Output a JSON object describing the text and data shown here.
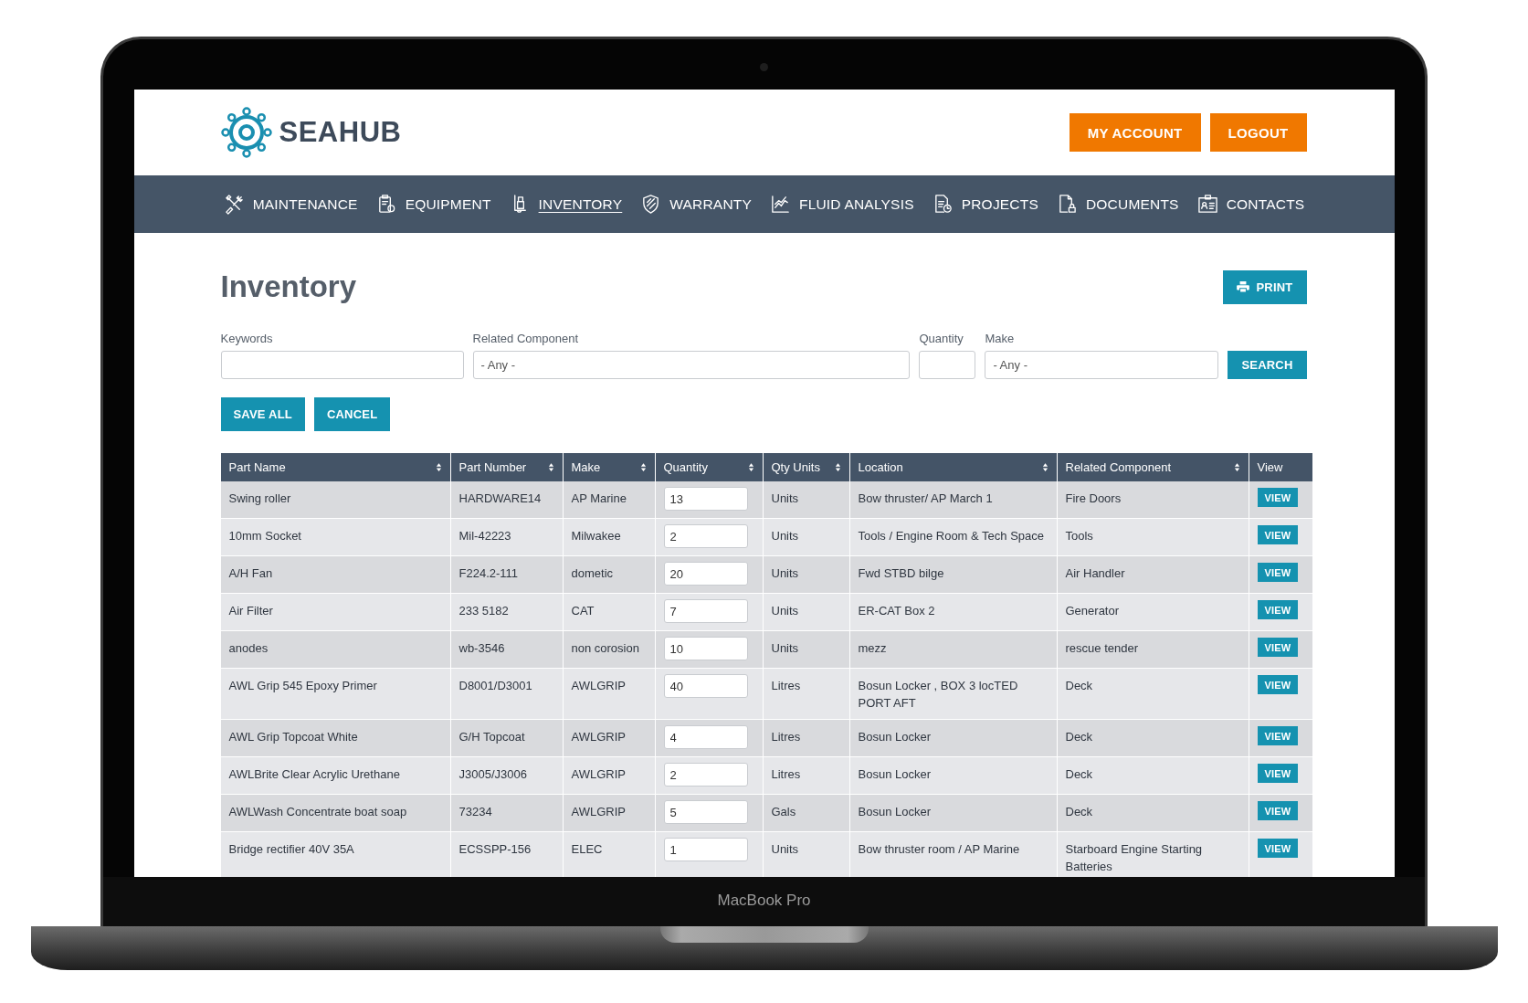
{
  "device": {
    "label": "MacBook Pro"
  },
  "header": {
    "brand": "SEAHUB",
    "buttons": [
      "MY ACCOUNT",
      "LOGOUT"
    ]
  },
  "nav": [
    {
      "label": "MAINTENANCE",
      "selected": false
    },
    {
      "label": "EQUIPMENT",
      "selected": false
    },
    {
      "label": "INVENTORY",
      "selected": true
    },
    {
      "label": "WARRANTY",
      "selected": false
    },
    {
      "label": "FLUID ANALYSIS",
      "selected": false
    },
    {
      "label": "PROJECTS",
      "selected": false
    },
    {
      "label": "DOCUMENTS",
      "selected": false
    },
    {
      "label": "CONTACTS",
      "selected": false
    }
  ],
  "page": {
    "title": "Inventory",
    "print_button": "PRINT"
  },
  "filters": [
    {
      "label": "Keywords",
      "kind": "text"
    },
    {
      "label": "Related Component",
      "kind": "select",
      "value": "- Any -"
    },
    {
      "label": "Quantity",
      "kind": "text"
    },
    {
      "label": "Make",
      "kind": "select",
      "value": "- Any -"
    }
  ],
  "search_button": "SEARCH",
  "actions": [
    "SAVE ALL",
    "CANCEL"
  ],
  "table": {
    "columns": [
      {
        "label": "Part Name",
        "sortable": true,
        "kind": "text"
      },
      {
        "label": "Part Number",
        "sortable": true,
        "kind": "text"
      },
      {
        "label": "Make",
        "sortable": true,
        "kind": "text"
      },
      {
        "label": "Quantity",
        "sortable": true,
        "kind": "input"
      },
      {
        "label": "Qty Units",
        "sortable": true,
        "kind": "text"
      },
      {
        "label": "Location",
        "sortable": true,
        "kind": "text"
      },
      {
        "label": "Related Component",
        "sortable": true,
        "kind": "text"
      },
      {
        "label": "View",
        "sortable": false,
        "kind": "button"
      }
    ],
    "rows": [
      [
        "Swing roller",
        "HARDWARE14",
        "AP Marine",
        "13",
        "Units",
        "Bow thruster/ AP March 1",
        "Fire Doors",
        "VIEW"
      ],
      [
        "10mm Socket",
        "Mil-42223",
        "Milwakee",
        "2",
        "Units",
        "Tools / Engine Room & Tech Space",
        "Tools",
        "VIEW"
      ],
      [
        "A/H Fan",
        "F224.2-111",
        "dometic",
        "20",
        "Units",
        "Fwd STBD bilge",
        "Air Handler",
        "VIEW"
      ],
      [
        "Air Filter",
        "233 5182",
        "CAT",
        "7",
        "Units",
        "ER-CAT Box 2",
        "Generator",
        "VIEW"
      ],
      [
        "anodes",
        "wb-3546",
        "non corosion",
        "10",
        "Units",
        "mezz",
        "rescue tender",
        "VIEW"
      ],
      [
        "AWL Grip 545 Epoxy Primer",
        "D8001/D3001",
        "AWLGRIP",
        "40",
        "Litres",
        "Bosun Locker , BOX 3 locTED PORT AFT",
        "Deck",
        "VIEW"
      ],
      [
        "AWL Grip Topcoat White",
        "G/H Topcoat",
        "AWLGRIP",
        "4",
        "Litres",
        "Bosun Locker",
        "Deck",
        "VIEW"
      ],
      [
        "AWLBrite Clear Acrylic Urethane",
        "J3005/J3006",
        "AWLGRIP",
        "2",
        "Litres",
        "Bosun Locker",
        "Deck",
        "VIEW"
      ],
      [
        "AWLWash Concentrate boat soap",
        "73234",
        "AWLGRIP",
        "5",
        "Gals",
        "Bosun Locker",
        "Deck",
        "VIEW"
      ],
      [
        "Bridge rectifier 40V 35A",
        "ECSSPP-156",
        "ELEC",
        "1",
        "Units",
        "Bow thruster room / AP Marine",
        "Starboard Engine Starting Batteries",
        "VIEW"
      ]
    ]
  }
}
